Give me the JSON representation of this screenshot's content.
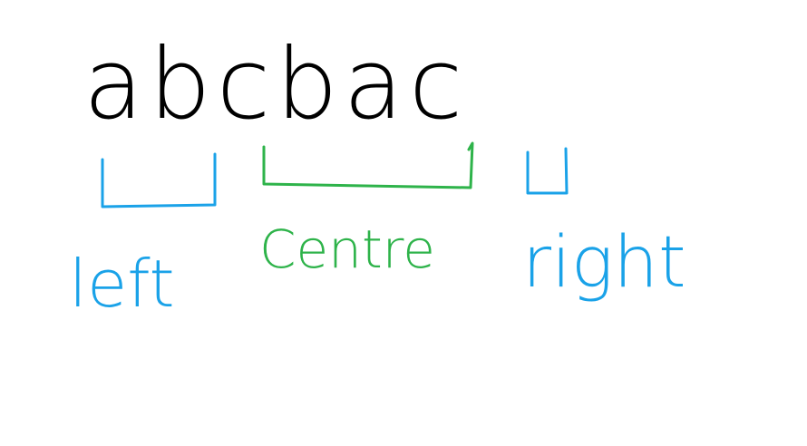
{
  "letters": {
    "sequence": "abcbac",
    "color": "#000000"
  },
  "labels": {
    "left": "left",
    "centre": "Centre",
    "right": "right"
  },
  "colors": {
    "left": "#1aa2e8",
    "centre": "#2eb34a",
    "right": "#1aa2e8"
  }
}
